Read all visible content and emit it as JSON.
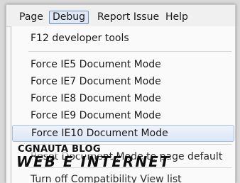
{
  "menubar": {
    "items": [
      "Page",
      "Debug",
      "Report Issue",
      "Help"
    ],
    "active": "Debug"
  },
  "dropdown": {
    "items": [
      "F12 developer tools",
      "Force IE5 Document Mode",
      "Force IE7 Document Mode",
      "Force IE8 Document Mode",
      "Force IE9 Document Mode",
      "Force IE10 Document Mode",
      "Reset Document Mode to page default",
      "Turn off Compatibility View list"
    ],
    "highlighted": "Force IE10 Document Mode"
  },
  "watermark": {
    "top": "CGNAUTA BLOG",
    "main": "WEB E INTERNET"
  }
}
